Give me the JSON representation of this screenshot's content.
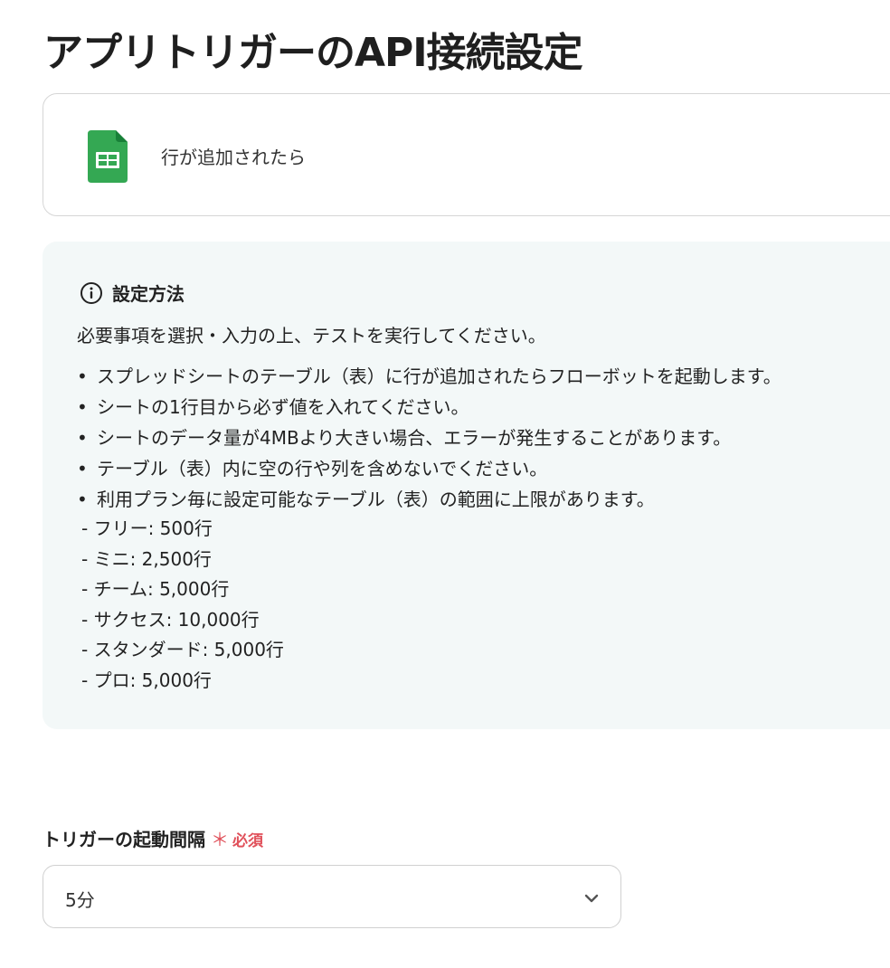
{
  "page": {
    "title": "アプリトリガーのAPI接続設定"
  },
  "trigger": {
    "app_icon": "google-sheets-icon",
    "label": "行が追加されたら"
  },
  "info": {
    "icon": "info-circle-icon",
    "title": "設定方法",
    "intro": "必要事項を選択・入力の上、テストを実行してください。",
    "bullets": [
      "スプレッドシートのテーブル（表）に行が追加されたらフローボットを起動します。",
      "シートの1行目から必ず値を入れてください。",
      "シートのデータ量が4MBより大きい場合、エラーが発生することがあります。",
      "テーブル（表）内に空の行や列を含めないでください。",
      "利用プラン毎に設定可能なテーブル（表）の範囲に上限があります。"
    ],
    "plans": [
      "- フリー: 500行",
      "- ミニ: 2,500行",
      "- チーム: 5,000行",
      "- サクセス: 10,000行",
      "- スタンダード: 5,000行",
      "- プロ: 5,000行"
    ]
  },
  "interval_field": {
    "label": "トリガーの起動間隔",
    "required_mark": "＊",
    "required_text": "必須",
    "selected_value": "5分",
    "dropdown_icon": "chevron-down-icon"
  },
  "colors": {
    "required": "#e0505a",
    "info_bg": "#f3f8f8",
    "sheets_green": "#34a853"
  }
}
